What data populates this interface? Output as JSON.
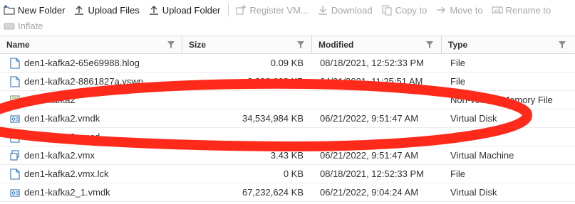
{
  "toolbar": {
    "row1": [
      {
        "key": "new_folder",
        "label": "New Folder",
        "icon": "new-folder-icon",
        "enabled": true
      },
      {
        "key": "upload_files",
        "label": "Upload Files",
        "icon": "upload-icon",
        "enabled": true
      },
      {
        "key": "upload_folder",
        "label": "Upload Folder",
        "icon": "upload-icon",
        "enabled": true
      },
      {
        "key": "register_vm",
        "label": "Register VM...",
        "icon": "register-vm-icon",
        "enabled": false
      },
      {
        "key": "download",
        "label": "Download",
        "icon": "download-icon",
        "enabled": false
      },
      {
        "key": "copy_to",
        "label": "Copy to",
        "icon": "copy-icon",
        "enabled": false
      },
      {
        "key": "move_to",
        "label": "Move to",
        "icon": "move-icon",
        "enabled": false
      },
      {
        "key": "rename_to",
        "label": "Rename to",
        "icon": "rename-icon",
        "enabled": false
      }
    ],
    "row2": [
      {
        "key": "inflate",
        "label": "Inflate",
        "icon": "inflate-icon",
        "enabled": false
      }
    ]
  },
  "columns": {
    "name": "Name",
    "size": "Size",
    "modified": "Modified",
    "type": "Type"
  },
  "files": [
    {
      "name": "den1-kafka2-65e69988.hlog",
      "size": "0.09 KB",
      "modified": "08/18/2021, 12:52:33 PM",
      "type": "File",
      "icon": "file-icon"
    },
    {
      "name": "den1-kafka2-8861827a.vswp",
      "size": "8,388,608 KB",
      "modified": "04/01/2021, 11:25:51 AM",
      "type": "File",
      "icon": "file-icon"
    },
    {
      "name": "den1-kafka2",
      "size": "",
      "modified": "",
      "type": "Non-volatile Memory File",
      "icon": "nvram-icon"
    },
    {
      "name": "den1-kafka2.vmdk",
      "size": "34,534,984 KB",
      "modified": "06/21/2022, 9:51:47 AM",
      "type": "Virtual Disk",
      "icon": "virtual-disk-icon"
    },
    {
      "name": "den1-kafka2.vmsd",
      "size": "",
      "modified": "",
      "type": "File",
      "icon": "file-icon"
    },
    {
      "name": "den1-kafka2.vmx",
      "size": "3.43 KB",
      "modified": "06/21/2022, 9:51:47 AM",
      "type": "Virtual Machine",
      "icon": "virtual-machine-icon"
    },
    {
      "name": "den1-kafka2.vmx.lck",
      "size": "0 KB",
      "modified": "08/18/2021, 12:52:33 PM",
      "type": "File",
      "icon": "file-icon"
    },
    {
      "name": "den1-kafka2_1.vmdk",
      "size": "67,232,624 KB",
      "modified": "06/21/2022, 9:04:24 AM",
      "type": "Virtual Disk",
      "icon": "virtual-disk-icon"
    }
  ],
  "colors": {
    "annotation": "#ff2a1a",
    "enabled_text": "#1a1a1a",
    "disabled_text": "#a6a6a6",
    "icon_blue": "#2f6fb5"
  }
}
